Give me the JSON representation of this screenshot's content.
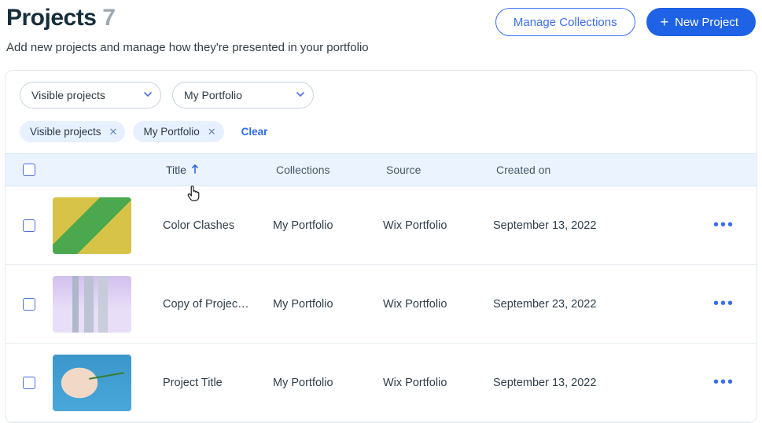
{
  "header": {
    "title": "Projects",
    "count": "7",
    "subtitle": "Add new projects and manage how they're presented in your portfolio",
    "manage_btn": "Manage Collections",
    "new_btn": "New Project"
  },
  "filters": {
    "select_visibility": "Visible projects",
    "select_collection": "My Portfolio"
  },
  "chips": {
    "chip1": "Visible projects",
    "chip2": "My Portfolio",
    "clear": "Clear"
  },
  "columns": {
    "title": "Title",
    "collections": "Collections",
    "source": "Source",
    "created": "Created on"
  },
  "rows": [
    {
      "title": "Color Clashes",
      "collections": "My Portfolio",
      "source": "Wix Portfolio",
      "created": "September 13, 2022"
    },
    {
      "title": "Copy of Projec…",
      "collections": "My Portfolio",
      "source": "Wix Portfolio",
      "created": "September 23, 2022"
    },
    {
      "title": "Project Title",
      "collections": "My Portfolio",
      "source": "Wix Portfolio",
      "created": "September 13, 2022"
    }
  ]
}
